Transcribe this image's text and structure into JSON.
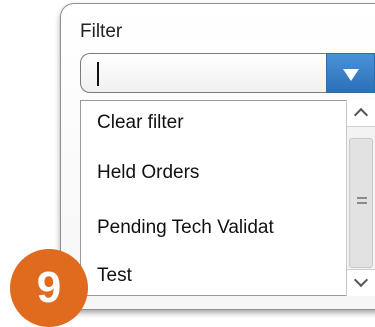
{
  "filter": {
    "label": "Filter",
    "value": "",
    "dropdown_icon": "triangle-down-icon"
  },
  "options": [
    {
      "label": "Clear filter"
    },
    {
      "label": "Held Orders"
    },
    {
      "label": "Pending Tech Validat"
    },
    {
      "label": "Test"
    }
  ],
  "scrollbar": {
    "up_icon": "chevron-up-icon",
    "down_icon": "chevron-down-icon",
    "grip_icon": "grip-icon"
  },
  "step_badge": {
    "number": "9"
  },
  "colors": {
    "dropdown_button": "#3a82c8",
    "badge": "#e06a1e"
  }
}
